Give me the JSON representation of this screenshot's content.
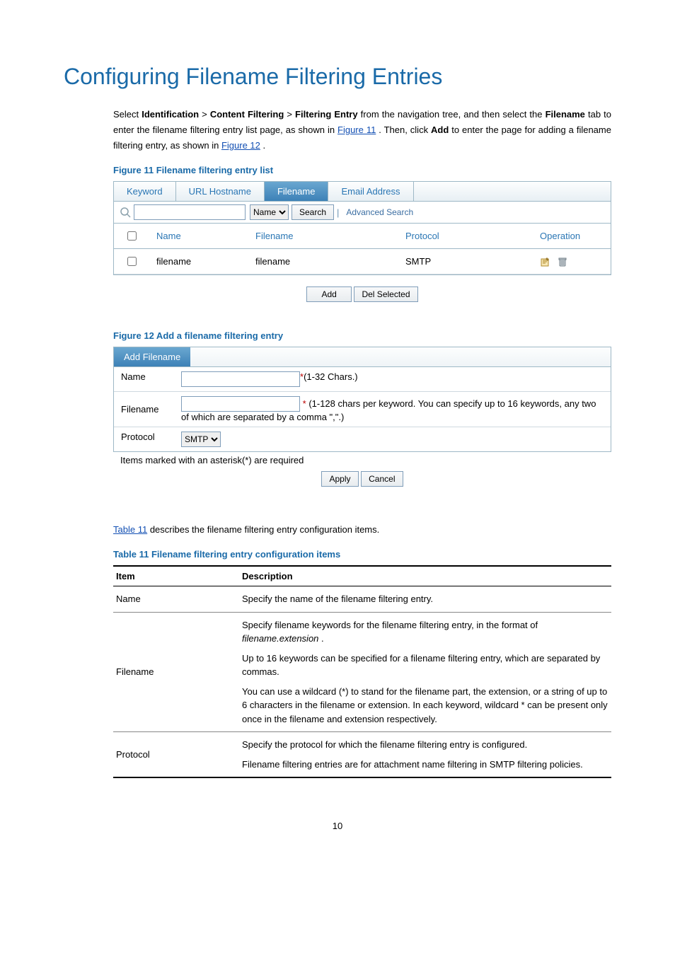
{
  "title": "Configuring Filename Filtering Entries",
  "intro": {
    "pre": "Select ",
    "nav1": "Identification",
    "gt1": " > ",
    "nav2": "Content Filtering",
    "gt2": " > ",
    "nav3": "Filtering Entry",
    "post1": " from the navigation tree, and then select the ",
    "tabname": "Filename",
    "post2": " tab to enter the filename filtering entry list page, as shown in ",
    "figref1": "Figure 11",
    "post3": ". Then, click ",
    "addword": "Add",
    "post4": " to enter the page for adding a filename filtering entry, as shown in ",
    "figref2": "Figure 12",
    "post5": "."
  },
  "fig11": {
    "caption": "Figure 11 Filename filtering entry list",
    "tabs": [
      "Keyword",
      "URL Hostname",
      "Filename",
      "Email Address"
    ],
    "active_tab_index": 2,
    "search_select_options": [
      "Name"
    ],
    "search_select_value": "Name",
    "search_button": "Search",
    "advanced": "Advanced Search",
    "columns": [
      "",
      "Name",
      "Filename",
      "Protocol",
      "Operation"
    ],
    "rows": [
      {
        "name": "filename",
        "filename": "filename",
        "protocol": "SMTP"
      }
    ],
    "add_btn": "Add",
    "del_btn": "Del Selected"
  },
  "fig12": {
    "caption": "Figure 12 Add a filename filtering entry",
    "tab_label": "Add Filename",
    "name_label": "Name",
    "name_hint": "(1-32 Chars.)",
    "filename_label": "Filename",
    "filename_hint": "(1-128 chars per keyword. You can specify up to 16 keywords, any two of which are separated by a comma \",\".)",
    "protocol_label": "Protocol",
    "protocol_value": "SMTP",
    "note": "Items marked with an asterisk(*) are required",
    "apply": "Apply",
    "cancel": "Cancel"
  },
  "table_intro": {
    "pre": "",
    "link": "Table 11",
    "post": " describes the filename filtering entry configuration items."
  },
  "table11": {
    "caption": "Table 11 Filename filtering entry configuration items",
    "head": {
      "item": "Item",
      "desc": "Description"
    },
    "rows": {
      "name": {
        "item": "Name",
        "desc": "Specify the name of the filename filtering entry."
      },
      "filename": {
        "item": "Filename",
        "p1a": "Specify filename keywords for the filename filtering entry, in the format of ",
        "p1b": "filename.extension",
        "p1c": ".",
        "p2": "Up to 16 keywords can be specified for a filename filtering entry, which are separated by commas.",
        "p3": "You can use a wildcard (*) to stand for the filename part, the extension, or a string of up to 6 characters in the filename or extension. In each keyword, wildcard * can be present only once in the filename and extension respectively."
      },
      "protocol": {
        "item": "Protocol",
        "p1": "Specify the protocol for which the filename filtering entry is configured.",
        "p2": "Filename filtering entries are for attachment name filtering in SMTP filtering policies."
      }
    }
  },
  "page_number": "10"
}
